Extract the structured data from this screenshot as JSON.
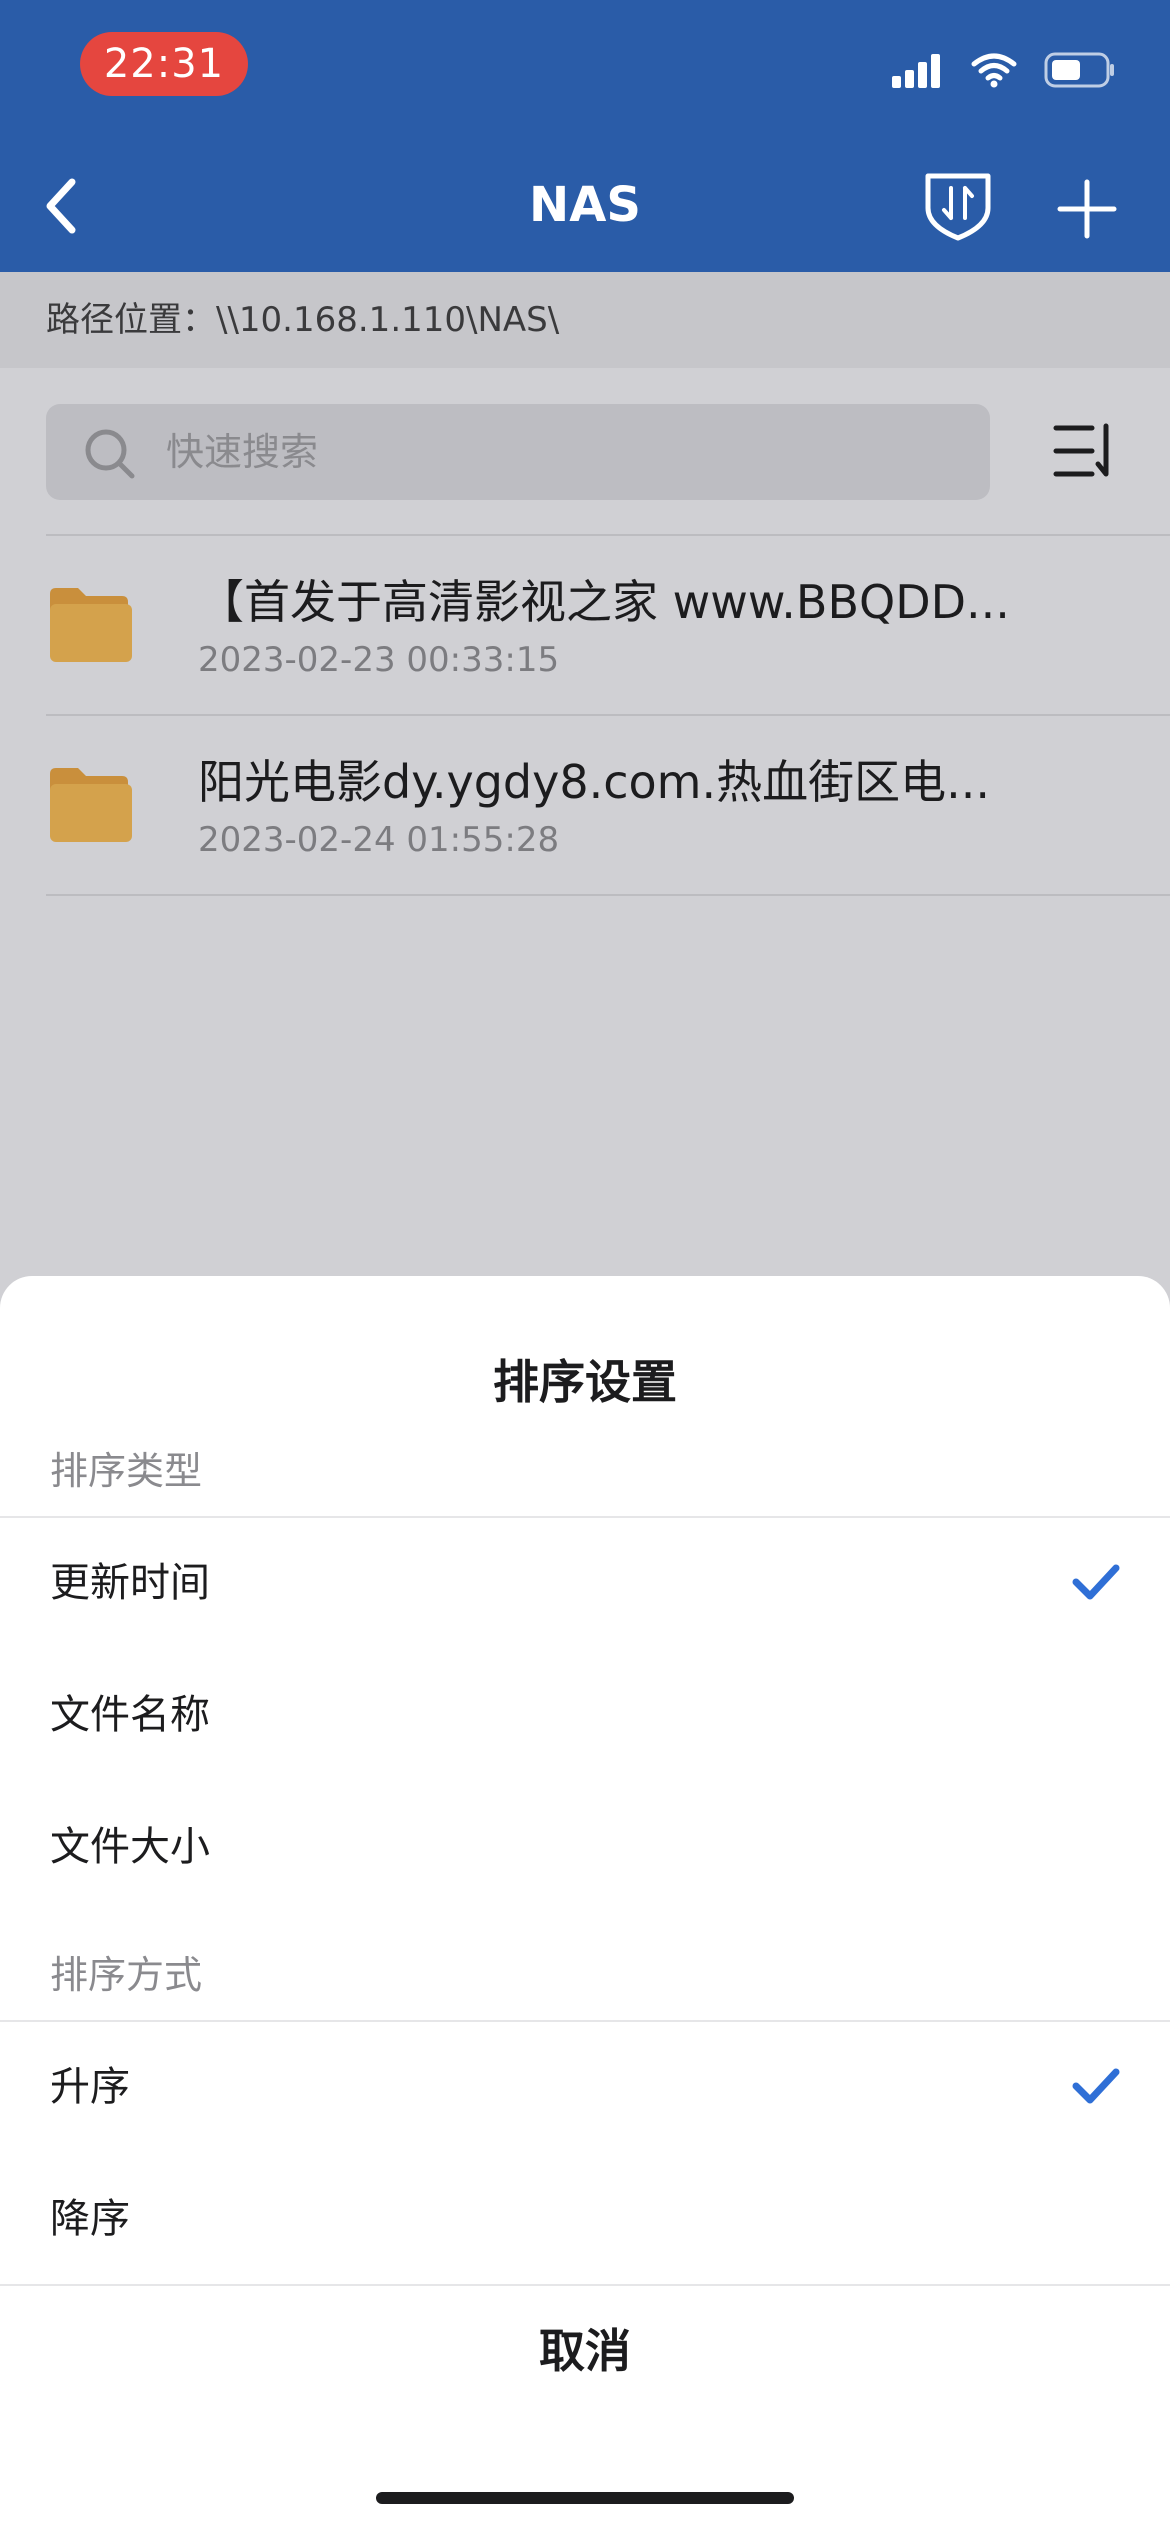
{
  "status_bar": {
    "time": "22:31"
  },
  "header": {
    "title": "NAS"
  },
  "path_bar": {
    "label": "路径位置：",
    "path": "\\\\10.168.1.110\\NAS\\"
  },
  "search": {
    "placeholder": "快速搜索"
  },
  "files": [
    {
      "name": "【首发于高清影视之家 www.BBQDD...",
      "date": "2023-02-23 00:33:15"
    },
    {
      "name": "阳光电影dy.ygdy8.com.热血街区电...",
      "date": "2023-02-24 01:55:28"
    }
  ],
  "sort_sheet": {
    "title": "排序设置",
    "type_section": "排序类型",
    "type_options": [
      {
        "label": "更新时间",
        "selected": true
      },
      {
        "label": "文件名称",
        "selected": false
      },
      {
        "label": "文件大小",
        "selected": false
      }
    ],
    "order_section": "排序方式",
    "order_options": [
      {
        "label": "升序",
        "selected": true
      },
      {
        "label": "降序",
        "selected": false
      }
    ],
    "cancel_label": "取消"
  },
  "colors": {
    "header_bg": "#2a5ca8",
    "accent": "#2f6fd6",
    "time_pill": "#e5463f",
    "folder": "#d4a24c"
  }
}
